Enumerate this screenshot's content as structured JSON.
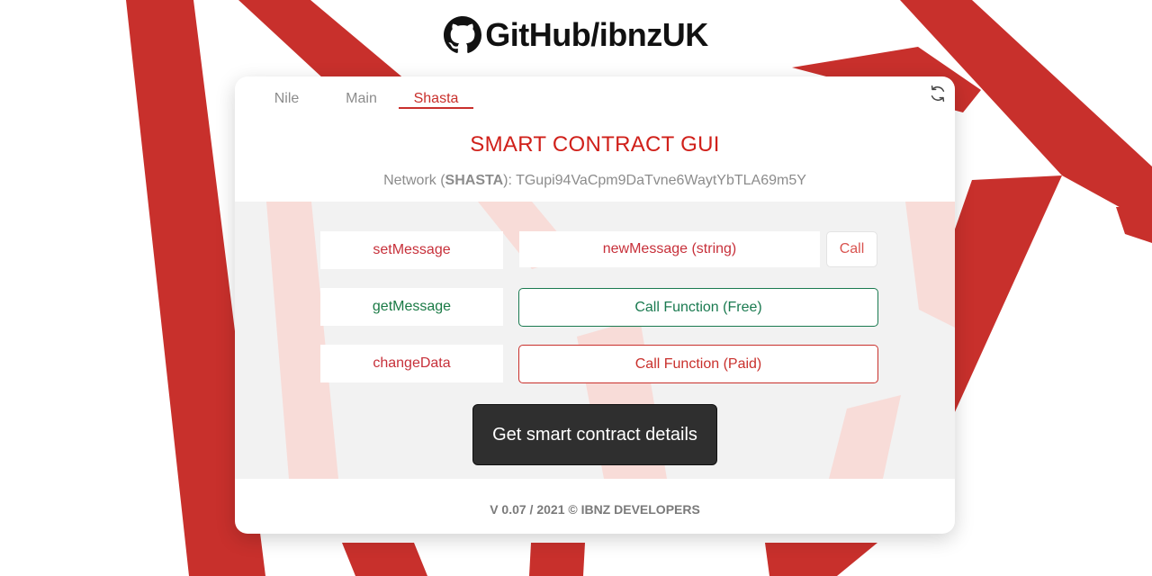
{
  "brand": {
    "icon": "github-octocat-icon",
    "text": "GitHub/ibnzUK"
  },
  "tabs": [
    {
      "label": "Nile",
      "active": false
    },
    {
      "label": "Main",
      "active": false
    },
    {
      "label": "Shasta",
      "active": true
    }
  ],
  "header": {
    "title": "SMART CONTRACT GUI",
    "network_prefix": "Network (",
    "network_name": "SHASTA",
    "network_suffix": "): ",
    "contract_address": "TGupi94VaCpm9DaTvne6WaytYbTLA69m5Y"
  },
  "functions": {
    "set_message": {
      "label": "setMessage",
      "input_placeholder": "newMessage (string)",
      "call_label": "Call"
    },
    "get_message": {
      "label": "getMessage",
      "button_label": "Call Function (Free)"
    },
    "change_data": {
      "label": "changeData",
      "button_label": "Call Function (Paid)"
    }
  },
  "details_button": "Get smart contract details",
  "footer": "V 0.07 / 2021 © IBNZ DEVELOPERS",
  "colors": {
    "accent_red": "#c9302c",
    "free_green": "#1a7a50",
    "dark_button": "#2f2f2f",
    "background_stripe": "#c9302c"
  }
}
